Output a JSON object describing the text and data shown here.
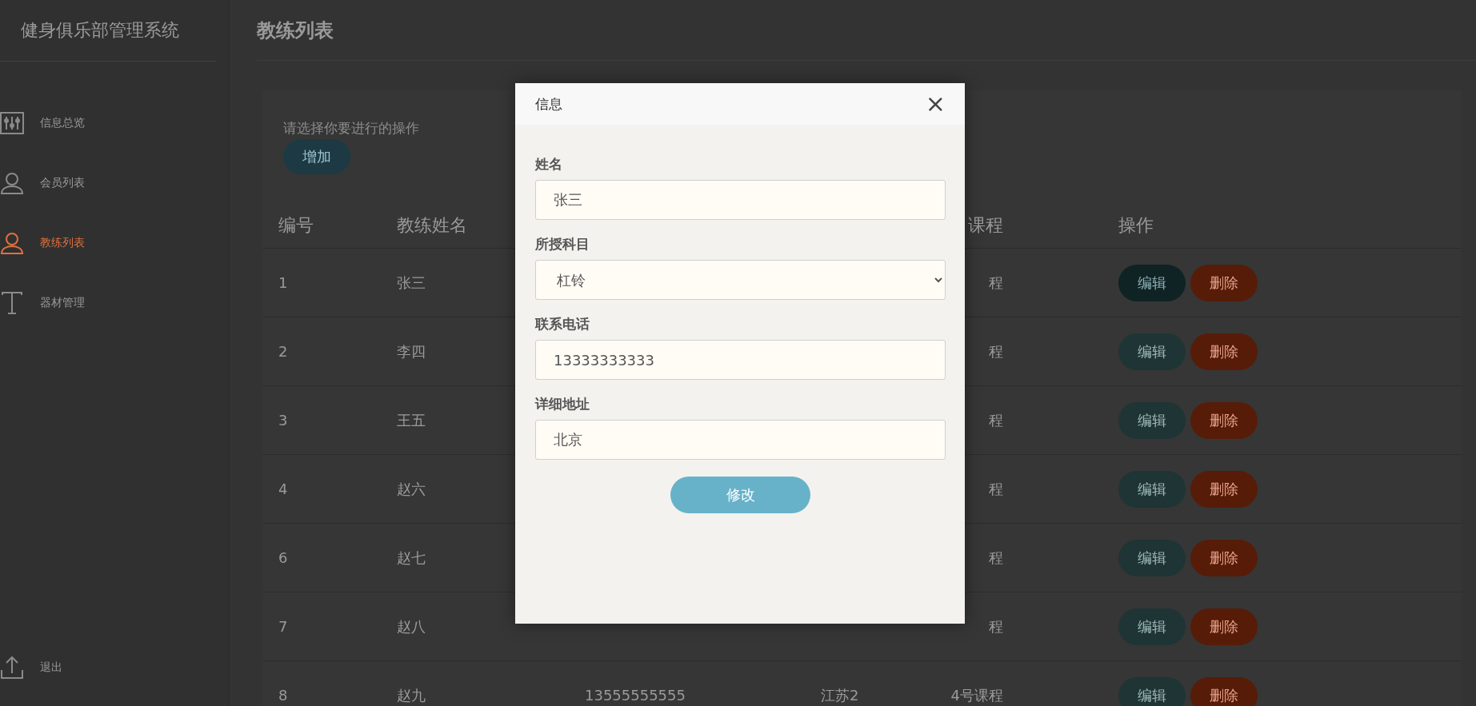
{
  "sidebar": {
    "title": "健身俱乐部管理系统",
    "items": [
      {
        "label": "信息总览",
        "selected": false
      },
      {
        "label": "会员列表",
        "selected": false
      },
      {
        "label": "教练列表",
        "selected": true
      },
      {
        "label": "器材管理",
        "selected": false
      }
    ],
    "logout": {
      "label": "退出"
    }
  },
  "page": {
    "title": "教练列表"
  },
  "toolbar": {
    "prompt": "请选择你要进行的操作",
    "add_button": "增加"
  },
  "table": {
    "columns": [
      "编号",
      "教练姓名",
      "",
      "",
      "课程",
      "操作"
    ],
    "rows": [
      {
        "cells": [
          "1",
          "张三",
          "",
          "",
          "程"
        ],
        "edit": "编辑",
        "delete": "删除",
        "edit_highlighted": true
      },
      {
        "cells": [
          "2",
          "李四",
          "",
          "",
          "程"
        ],
        "edit": "编辑",
        "delete": "删除",
        "edit_highlighted": false
      },
      {
        "cells": [
          "3",
          "王五",
          "",
          "",
          "程"
        ],
        "edit": "编辑",
        "delete": "删除",
        "edit_highlighted": false
      },
      {
        "cells": [
          "4",
          "赵六",
          "",
          "",
          "程"
        ],
        "edit": "编辑",
        "delete": "删除",
        "edit_highlighted": false
      },
      {
        "cells": [
          "6",
          "赵七",
          "",
          "",
          "程"
        ],
        "edit": "编辑",
        "delete": "删除",
        "edit_highlighted": false
      },
      {
        "cells": [
          "7",
          "赵八",
          "",
          "",
          "程"
        ],
        "edit": "编辑",
        "delete": "删除",
        "edit_highlighted": false
      },
      {
        "cells": [
          "8",
          "赵九",
          "13555555555",
          "江苏2",
          "4号课程"
        ],
        "edit": "编辑",
        "delete": "删除",
        "edit_highlighted": false
      }
    ]
  },
  "dialog": {
    "title": "信息",
    "close": "×",
    "fields": [
      {
        "label": "姓名",
        "kind": "text",
        "value": "张三"
      },
      {
        "label": "所授科目",
        "kind": "select",
        "value": "杠铃"
      },
      {
        "label": "联系电话",
        "kind": "text",
        "value": "13333333333"
      },
      {
        "label": "详细地址",
        "kind": "text",
        "value": "北京"
      }
    ],
    "submit": "修改"
  }
}
